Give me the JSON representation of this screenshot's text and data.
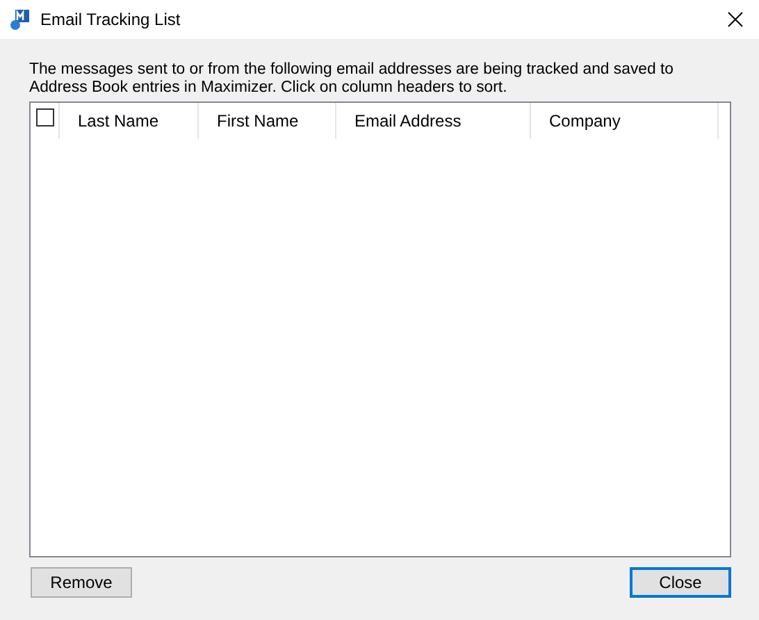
{
  "window": {
    "title": "Email Tracking List"
  },
  "description": "The messages sent to or from the following email addresses are being tracked and saved to Address Book entries in Maximizer. Click on column headers to sort.",
  "table": {
    "select_all": {
      "checked": false
    },
    "columns": [
      "Last Name",
      "First Name",
      "Email Address",
      "Company"
    ]
  },
  "buttons": [
    {
      "label": "Remove",
      "focused": false
    },
    {
      "label": "Close",
      "focused": true
    }
  ]
}
